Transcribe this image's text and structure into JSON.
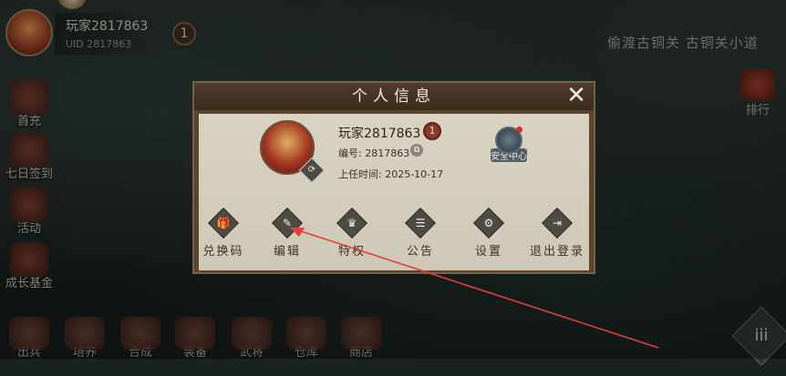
{
  "player": {
    "name": "玩家2817863",
    "uid": "UID 2817863",
    "level": "1"
  },
  "route": "偷渡古铜关 古铜关小道",
  "rank_label": "排行",
  "sidebar": [
    {
      "label": "首充",
      "icon": "chest-icon"
    },
    {
      "label": "七日签到",
      "icon": "gift-icon"
    },
    {
      "label": "活动",
      "icon": "drum-icon"
    },
    {
      "label": "成长基金",
      "icon": "coin-icon"
    }
  ],
  "bottom_nav": [
    {
      "label": "出兵",
      "icon": "drum-icon"
    },
    {
      "label": "培养",
      "icon": "sword-icon"
    },
    {
      "label": "合成",
      "icon": "orb-icon"
    },
    {
      "label": "装备",
      "icon": "armor-icon"
    },
    {
      "label": "武将",
      "icon": "general-icon"
    },
    {
      "label": "仓库",
      "icon": "chest-icon"
    },
    {
      "label": "商店",
      "icon": "shop-icon"
    }
  ],
  "corner_menu": "iii",
  "dialog": {
    "title": "个人信息",
    "close": "✕",
    "name": "玩家2817863",
    "level": "1",
    "id_line": "编号: 2817863",
    "time_line": "上任时间: 2025-10-17",
    "security_label": "安全中心",
    "actions": [
      {
        "label": "兑换码",
        "glyph": "🎁",
        "icon": "gift-icon"
      },
      {
        "label": "编辑",
        "glyph": "✎",
        "icon": "pen-icon"
      },
      {
        "label": "特权",
        "glyph": "♛",
        "icon": "crown-icon"
      },
      {
        "label": "公告",
        "glyph": "☰",
        "icon": "notice-icon"
      },
      {
        "label": "设置",
        "glyph": "⚙",
        "icon": "gear-icon"
      },
      {
        "label": "退出登录",
        "glyph": "⇥",
        "icon": "logout-icon"
      }
    ]
  },
  "colors": {
    "annotation_arrow": "#e0403a",
    "dialog_frame": "#5a4531",
    "panel": "#d9d3c2"
  }
}
